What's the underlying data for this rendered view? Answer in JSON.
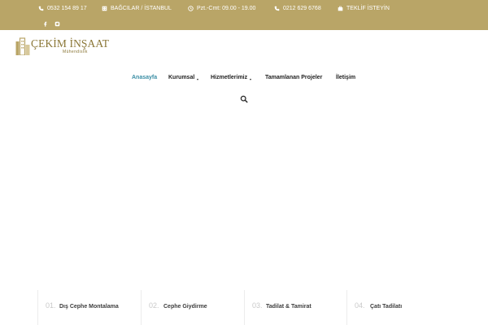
{
  "topbar": {
    "phone_mobile": "0532 154 89 17",
    "location": "BAĞCILAR / İSTANBUL",
    "hours": "Pzt.-Cmt: 09.00 - 19.00",
    "phone_office": "0212 629 6768",
    "quote": "TEKLİF İSTEYİN",
    "background_color": "#b9a567"
  },
  "logo": {
    "title": "ÇEKİM İNŞAAT",
    "subtitle": "Mühendislik",
    "color": "#8a7636"
  },
  "nav": {
    "items": [
      {
        "label": "Anasayfa",
        "active": true
      },
      {
        "label": "Kurumsal",
        "has_dropdown": true
      },
      {
        "label": "Hizmetlerimiz",
        "has_dropdown": true
      },
      {
        "label": "Tamamlanan Projeler"
      },
      {
        "label": "İletişim"
      }
    ],
    "active_color": "#3a8ea5"
  },
  "services": [
    {
      "num": "01.",
      "label": "Dış Cephe Montalama"
    },
    {
      "num": "02.",
      "label": "Cephe Giydirme"
    },
    {
      "num": "03.",
      "label": "Tadilat & Tamirat"
    },
    {
      "num": "04.",
      "label": "Çatı Tadilatı"
    }
  ]
}
